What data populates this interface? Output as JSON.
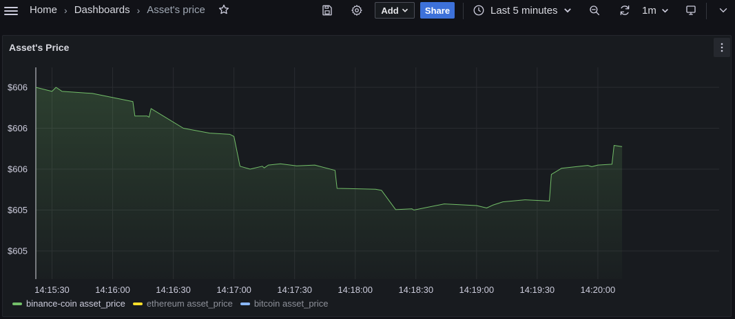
{
  "breadcrumb": {
    "home": "Home",
    "dashboards": "Dashboards",
    "current": "Asset's price"
  },
  "toolbar": {
    "add_label": "Add",
    "share_label": "Share",
    "time_range": "Last 5 minutes",
    "refresh_interval": "1m"
  },
  "panel": {
    "title": "Asset's Price"
  },
  "chart_data": {
    "type": "area",
    "title": "Asset's Price",
    "y_tick_labels": [
      "$606",
      "$606",
      "$606",
      "$605",
      "$605"
    ],
    "x_tick_labels": [
      "14:15:30",
      "14:16:00",
      "14:16:30",
      "14:17:00",
      "14:17:30",
      "14:18:00",
      "14:18:30",
      "14:19:00",
      "14:19:30",
      "14:20:00"
    ],
    "x_range": [
      "14:15:22",
      "14:21:00"
    ],
    "grid": true,
    "legend_placement": "bottom-left",
    "series": [
      {
        "name": "binance-coin asset_price",
        "color": "#73bf69",
        "points": [
          [
            "14:15:22",
            606.0
          ],
          [
            "14:15:30",
            605.99
          ],
          [
            "14:15:32",
            606.0
          ],
          [
            "14:15:35",
            605.99
          ],
          [
            "14:15:50",
            605.985
          ],
          [
            "14:16:10",
            605.965
          ],
          [
            "14:16:11",
            605.93
          ],
          [
            "14:16:17",
            605.93
          ],
          [
            "14:16:18",
            605.927
          ],
          [
            "14:16:19",
            605.948
          ],
          [
            "14:16:35",
            605.9
          ],
          [
            "14:16:48",
            605.888
          ],
          [
            "14:16:58",
            605.885
          ],
          [
            "14:17:00",
            605.88
          ],
          [
            "14:17:03",
            605.807
          ],
          [
            "14:17:08",
            605.8
          ],
          [
            "14:17:14",
            605.807
          ],
          [
            "14:17:15",
            605.803
          ],
          [
            "14:17:17",
            605.81
          ],
          [
            "14:17:23",
            605.813
          ],
          [
            "14:17:31",
            605.808
          ],
          [
            "14:17:40",
            605.81
          ],
          [
            "14:17:50",
            605.797
          ],
          [
            "14:17:51",
            605.753
          ],
          [
            "14:18:10",
            605.751
          ],
          [
            "14:18:13",
            605.748
          ],
          [
            "14:18:20",
            605.701
          ],
          [
            "14:18:28",
            605.703
          ],
          [
            "14:18:29",
            605.7
          ],
          [
            "14:18:44",
            605.715
          ],
          [
            "14:19:00",
            605.711
          ],
          [
            "14:19:05",
            605.705
          ],
          [
            "14:19:08",
            605.712
          ],
          [
            "14:19:13",
            605.72
          ],
          [
            "14:19:24",
            605.725
          ],
          [
            "14:19:36",
            605.722
          ],
          [
            "14:19:37",
            605.787
          ],
          [
            "14:19:42",
            605.802
          ],
          [
            "14:19:55",
            605.809
          ],
          [
            "14:19:57",
            605.806
          ],
          [
            "14:20:00",
            605.81
          ],
          [
            "14:20:07",
            605.812
          ],
          [
            "14:20:08",
            605.858
          ],
          [
            "14:20:12",
            605.855
          ]
        ]
      },
      {
        "name": "ethereum asset_price",
        "color": "#fade2a",
        "points": []
      },
      {
        "name": "bitcoin asset_price",
        "color": "#8ab8ff",
        "points": []
      }
    ]
  }
}
